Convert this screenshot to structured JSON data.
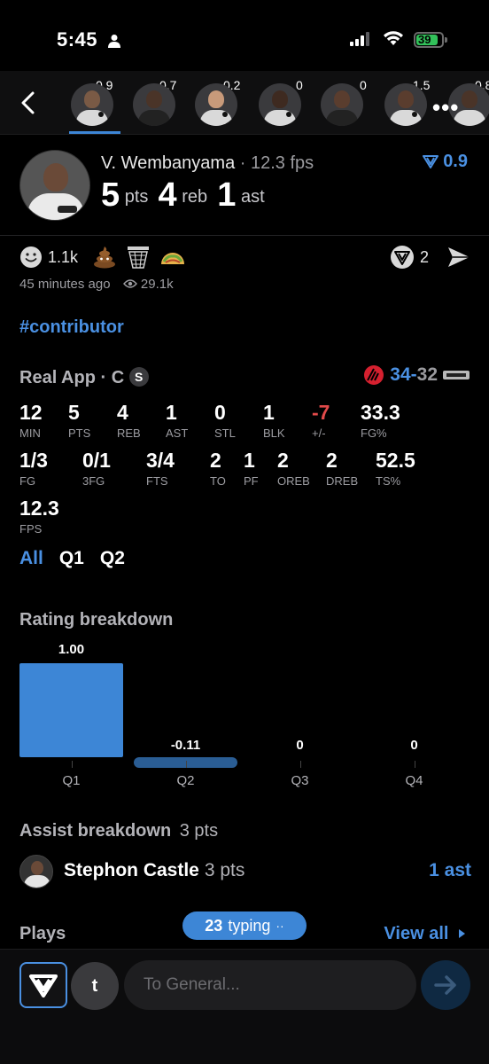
{
  "status_bar": {
    "time": "5:45",
    "battery": "39"
  },
  "player_strip": {
    "players": [
      {
        "score": "0.9"
      },
      {
        "score": "0.7"
      },
      {
        "score": "0.2"
      },
      {
        "score": "0"
      },
      {
        "score": "0"
      },
      {
        "score": "1.5"
      },
      {
        "score": "0.8"
      }
    ],
    "more": "•••"
  },
  "player": {
    "name": "V. Wembanyama",
    "separator": "·",
    "fps": "12.3 fps",
    "pts_value": "5",
    "pts_label": "pts",
    "reb_value": "4",
    "reb_label": "reb",
    "ast_value": "1",
    "ast_label": "ast",
    "rating": "0.9"
  },
  "reactions": {
    "smile_count": "1.1k",
    "time_ago": "45 minutes ago",
    "views": "29.1k",
    "comment_count": "2"
  },
  "hashtag": "#contributor",
  "box": {
    "title": "Real App · C",
    "badge": "S",
    "home_score": "34",
    "dash": "-",
    "away_score": "32",
    "row1": [
      {
        "value": "12",
        "label": "MIN"
      },
      {
        "value": "5",
        "label": "PTS"
      },
      {
        "value": "4",
        "label": "REB"
      },
      {
        "value": "1",
        "label": "AST"
      },
      {
        "value": "0",
        "label": "STL"
      },
      {
        "value": "1",
        "label": "BLK"
      },
      {
        "value": "-7",
        "label": "+/-"
      },
      {
        "value": "33.3",
        "label": "FG%"
      }
    ],
    "row2": [
      {
        "value": "1/3",
        "label": "FG"
      },
      {
        "value": "0/1",
        "label": "3FG"
      },
      {
        "value": "3/4",
        "label": "FTS"
      },
      {
        "value": "2",
        "label": "TO"
      },
      {
        "value": "1",
        "label": "PF"
      },
      {
        "value": "2",
        "label": "OREB"
      },
      {
        "value": "2",
        "label": "DREB"
      },
      {
        "value": "52.5",
        "label": "TS%"
      }
    ],
    "row3": [
      {
        "value": "12.3",
        "label": "FPS"
      }
    ]
  },
  "tabs": [
    "All",
    "Q1",
    "Q2"
  ],
  "rating_breakdown": {
    "title": "Rating breakdown"
  },
  "chart_data": {
    "type": "bar",
    "categories": [
      "Q1",
      "Q2",
      "Q3",
      "Q4"
    ],
    "values": [
      1.0,
      -0.11,
      0,
      0
    ],
    "labels": [
      "1.00",
      "-0.11",
      "0",
      "0"
    ],
    "colors": {
      "positive": "#3d86d6",
      "negative": "#2a5d94"
    }
  },
  "assist": {
    "title": "Assist breakdown",
    "title_pts": "3 pts",
    "name": "Stephon Castle",
    "pts": "3 pts",
    "ast": "1 ast"
  },
  "plays": {
    "title": "Plays",
    "typing_count": "23",
    "typing_label": "typing",
    "typing_dots": "··",
    "view_all": "View all"
  },
  "composer": {
    "t_label": "t",
    "placeholder": "To General..."
  },
  "colors": {
    "accent": "#4a90e2",
    "negative": "#e24a4a",
    "background": "#000000"
  }
}
